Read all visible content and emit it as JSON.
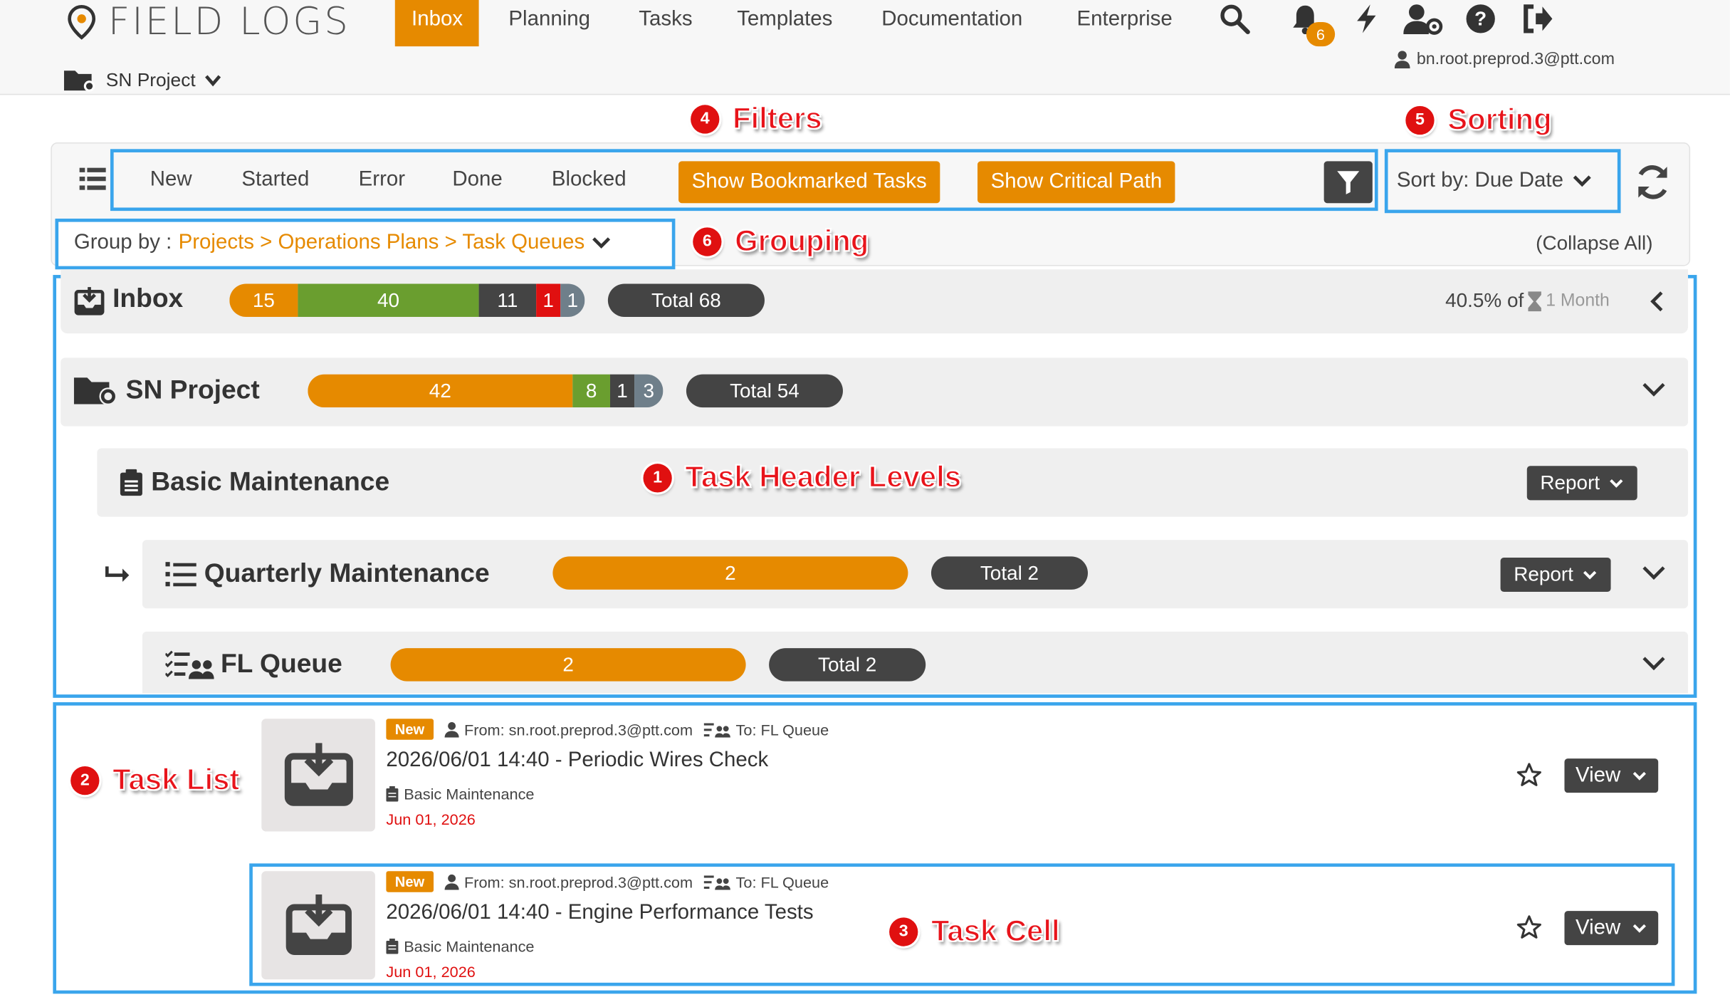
{
  "app": {
    "logo_text": "FIELD LOGS",
    "project": "SN Project",
    "user": "bn.root.preprod.3@ptt.com",
    "notif_count": "6"
  },
  "nav": [
    "Inbox",
    "Planning",
    "Tasks",
    "Templates",
    "Documentation",
    "Enterprise"
  ],
  "filters": [
    "New",
    "Started",
    "Error",
    "Done",
    "Blocked"
  ],
  "show_bookmarked": "Show Bookmarked Tasks",
  "show_critical": "Show Critical Path",
  "sort": "Sort by: Due Date",
  "group": {
    "prefix": "Group by : ",
    "path": "Projects > Operations Plans > Task Queues",
    "collapse": "(Collapse All)"
  },
  "inbox": {
    "label": "Inbox",
    "bars": [
      "15",
      "40",
      "11",
      "1",
      "1"
    ],
    "total": "Total 68",
    "pct": "40.5% of",
    "period": "1 Month"
  },
  "project": {
    "label": "SN Project",
    "bars": [
      "42",
      "8",
      "1",
      "3"
    ],
    "total": "Total 54"
  },
  "plan": {
    "label": "Basic Maintenance",
    "report": "Report"
  },
  "queue1": {
    "label": "Quarterly Maintenance",
    "bar": "2",
    "total": "Total 2",
    "report": "Report"
  },
  "queue2": {
    "label": "FL Queue",
    "bar": "2",
    "total": "Total 2"
  },
  "tasks": [
    {
      "status": "New",
      "from": "From: sn.root.preprod.3@ptt.com",
      "to": "To: FL Queue",
      "title": "2026/06/01 14:40 - Periodic Wires Check",
      "plan": "Basic Maintenance",
      "due": "Jun 01, 2026",
      "view": "View"
    },
    {
      "status": "New",
      "from": "From: sn.root.preprod.3@ptt.com",
      "to": "To: FL Queue",
      "title": "2026/06/01 14:40 - Engine Performance Tests",
      "plan": "Basic Maintenance",
      "due": "Jun 01, 2026",
      "view": "View"
    }
  ],
  "annotations": {
    "n1": "1",
    "a1": "Task Header Levels",
    "n2": "2",
    "a2": "Task List",
    "n3": "3",
    "a3": "Task Cell",
    "n4": "4",
    "a4": "Filters",
    "n5": "5",
    "a5": "Sorting",
    "n6": "6",
    "a6": "Grouping"
  },
  "colors": {
    "orange": "#e68a00",
    "green": "#6a9e2f",
    "dark": "#444444",
    "red": "#e01010",
    "gray": "#6f7f8a",
    "highlight": "#3aa5ec"
  }
}
